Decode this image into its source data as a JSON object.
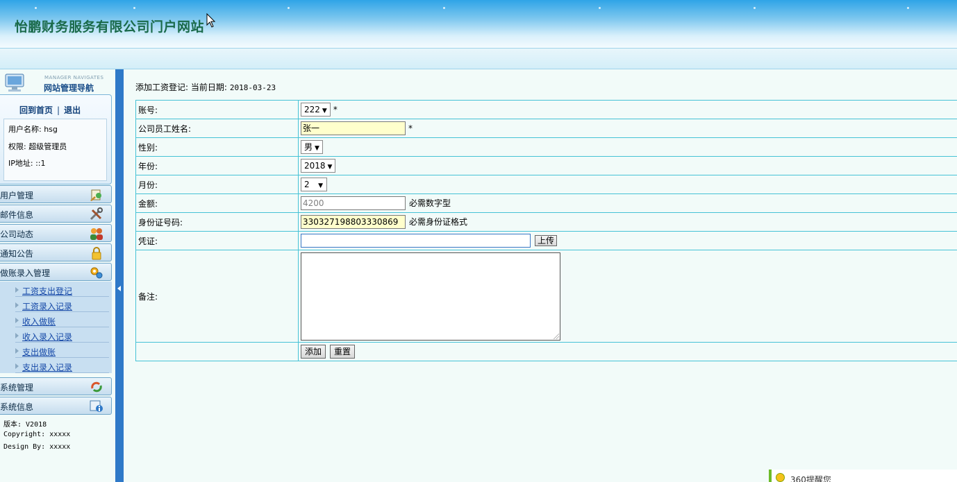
{
  "header": {
    "title": "怡鹏财务服务有限公司门户网站"
  },
  "sidebar": {
    "nav_en": "MANAGER NAVIGATES",
    "nav_cn": "网站管理导航",
    "home_link": "回到首页",
    "separator": "|",
    "logout_link": "退出",
    "user_name": "用户名称: hsg",
    "permission": "权限: 超级管理员",
    "ip": "IP地址: ::1",
    "menu": [
      {
        "label": "用户管理",
        "icon": "user-edit-icon"
      },
      {
        "label": "邮件信息",
        "icon": "tools-icon"
      },
      {
        "label": "公司动态",
        "icon": "people-icon"
      },
      {
        "label": "通知公告",
        "icon": "lock-icon"
      },
      {
        "label": "做账录入管理",
        "icon": "gears-icon"
      }
    ],
    "submenu": [
      {
        "label": "工资支出登记"
      },
      {
        "label": "工资录入记录"
      },
      {
        "label": "收入做账"
      },
      {
        "label": "收入录入记录"
      },
      {
        "label": "支出做账"
      },
      {
        "label": "支出录入记录"
      }
    ],
    "menu2": [
      {
        "label": "系统管理",
        "icon": "refresh-icon"
      },
      {
        "label": "系统信息",
        "icon": "info-icon"
      }
    ],
    "version": "版本:  V2018",
    "copyright": "Copyright: xxxxx",
    "design": "Design By:  xxxxx"
  },
  "main": {
    "crumb_label": "添加工资登记:  当前日期:",
    "current_date": "2018-03-23",
    "form": {
      "account_label": "账号:",
      "account_value": "222",
      "name_label": "公司员工姓名:",
      "name_value": "张一",
      "gender_label": "性别:",
      "gender_value": "男",
      "year_label": "年份:",
      "year_value": "2018",
      "month_label": "月份:",
      "month_value": "2",
      "amount_label": "金额:",
      "amount_value": "4200",
      "amount_hint": "必需数字型",
      "idcard_label": "身份证号码:",
      "idcard_value": "330327198803330869",
      "idcard_hint": "必需身份证格式",
      "voucher_label": "凭证:",
      "voucher_value": "",
      "upload_button": "上传",
      "remark_label": "备注:",
      "remark_value": "",
      "required_mark": "*",
      "add_button": "添加",
      "reset_button": "重置"
    }
  },
  "toast": {
    "text": "360提醒您"
  }
}
